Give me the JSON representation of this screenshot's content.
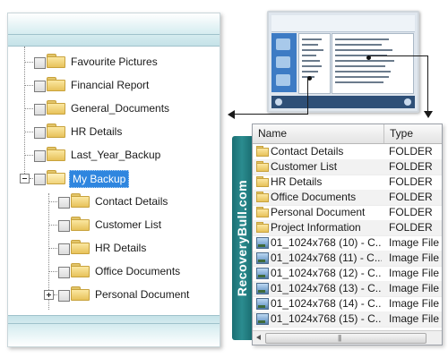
{
  "tree": {
    "items": [
      {
        "label": "Favourite Pictures"
      },
      {
        "label": "Financial Report"
      },
      {
        "label": "General_Documents"
      },
      {
        "label": "HR Details"
      },
      {
        "label": "Last_Year_Backup"
      },
      {
        "label": "My Backup",
        "selected": true,
        "expanded": true,
        "children": [
          {
            "label": "Contact Details"
          },
          {
            "label": "Customer List"
          },
          {
            "label": "HR Details"
          },
          {
            "label": "Office Documents"
          },
          {
            "label": "Personal Document",
            "collapsed": true
          }
        ]
      }
    ]
  },
  "brand": {
    "text": "RecoveryBull.com"
  },
  "file_list": {
    "columns": {
      "name": "Name",
      "type": "Type"
    },
    "rows": [
      {
        "icon": "folder-icon",
        "name": "Contact Details",
        "type": "FOLDER"
      },
      {
        "icon": "folder-icon",
        "name": "Customer List",
        "type": "FOLDER"
      },
      {
        "icon": "folder-icon",
        "name": "HR Details",
        "type": "FOLDER"
      },
      {
        "icon": "folder-icon",
        "name": "Office Documents",
        "type": "FOLDER"
      },
      {
        "icon": "folder-icon",
        "name": "Personal Document",
        "type": "FOLDER"
      },
      {
        "icon": "folder-icon",
        "name": "Project Information",
        "type": "FOLDER"
      },
      {
        "icon": "image-file-icon",
        "name": "01_1024x768 (10) - C...",
        "type": "Image File"
      },
      {
        "icon": "image-file-icon",
        "name": "01_1024x768 (11) - C...",
        "type": "Image File"
      },
      {
        "icon": "image-file-icon",
        "name": "01_1024x768 (12) - C...",
        "type": "Image File"
      },
      {
        "icon": "image-file-icon",
        "name": "01_1024x768 (13) - C...",
        "type": "Image File"
      },
      {
        "icon": "image-file-icon",
        "name": "01_1024x768 (14) - C...",
        "type": "Image File"
      },
      {
        "icon": "image-file-icon",
        "name": "01_1024x768 (15) - C...",
        "type": "Image File"
      }
    ],
    "scroll_grip": "|||"
  }
}
